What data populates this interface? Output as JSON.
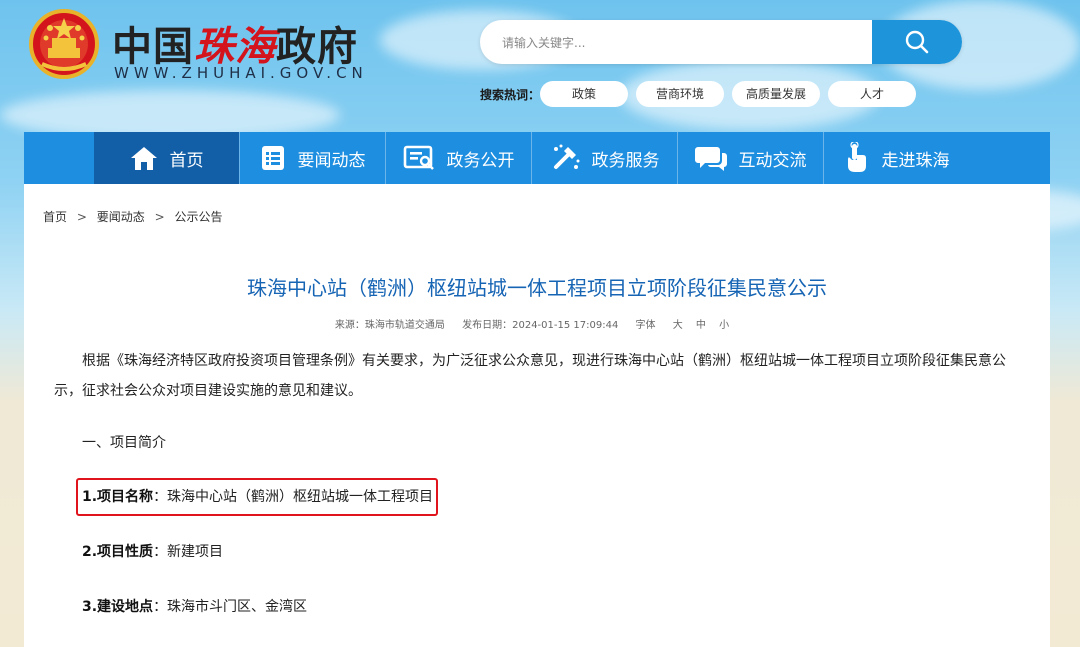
{
  "header": {
    "site_name_prefix": "中国",
    "site_name_script": "珠海",
    "site_name_suffix": "政府",
    "site_url": "WWW.ZHUHAI.GOV.CN"
  },
  "search": {
    "placeholder": "请输入关键字...",
    "hot_label": "搜索热词：",
    "hot_tags": [
      "政策",
      "营商环境",
      "高质量发展",
      "人才"
    ]
  },
  "nav": {
    "items": [
      {
        "label": "首页",
        "icon": "home-icon"
      },
      {
        "label": "要闻动态",
        "icon": "news-list-icon"
      },
      {
        "label": "政务公开",
        "icon": "open-affairs-icon"
      },
      {
        "label": "政务服务",
        "icon": "service-tools-icon"
      },
      {
        "label": "互动交流",
        "icon": "chat-icon"
      },
      {
        "label": "走进珠海",
        "icon": "pointing-hand-icon"
      }
    ]
  },
  "breadcrumb": [
    "首页",
    "要闻动态",
    "公示公告"
  ],
  "breadcrumb_separator": ">",
  "article": {
    "title": "珠海中心站（鹤洲）枢纽站城一体工程项目立项阶段征集民意公示",
    "meta": {
      "source": "来源：珠海市轨道交通局",
      "date": "发布日期：2024-01-15 17:09:44",
      "font_label": "字体",
      "font_large": "大",
      "font_medium": "中",
      "font_small": "小"
    },
    "intro": "根据《珠海经济特区政府投资项目管理条例》有关要求，为广泛征求公众意见，现进行珠海中心站（鹤洲）枢纽站城一体工程项目立项阶段征集民意公示，征求社会公众对项目建设实施的意见和建议。",
    "section_heading": "一、项目简介",
    "items": [
      {
        "label": "1.项目名称",
        "value": "：珠海中心站（鹤洲）枢纽站城一体工程项目"
      },
      {
        "label": "2.项目性质",
        "value": "：新建项目"
      },
      {
        "label": "3.建设地点",
        "value": "：珠海市斗门区、金湾区"
      }
    ]
  },
  "colors": {
    "nav_bg": "#1e8ee0",
    "nav_active": "#125fa8",
    "title": "#1664b4",
    "highlight": "#e0141c"
  }
}
